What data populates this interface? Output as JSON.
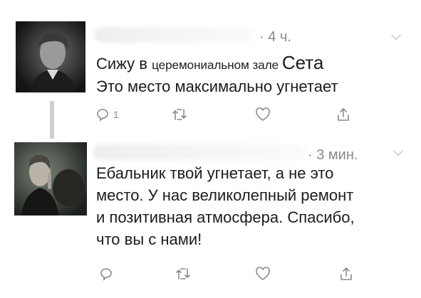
{
  "tweets": [
    {
      "time": "· 4 ч.",
      "text_line1_a": "Сижу в ",
      "text_line1_b": "церемониальном зале ",
      "text_line1_c": "Сета",
      "text_line2": "Это место максимально угнетает",
      "reply_count": "1"
    },
    {
      "time": "· 3 мин.",
      "text_lines": [
        "Ебальник твой угнетает, а не это",
        "место. У нас великолепный ремонт",
        "и позитивная атмосфера. Спасибо,",
        "что вы с нами!"
      ],
      "reply_count": ""
    }
  ],
  "icons": {
    "reply": "reply-icon",
    "retweet": "retweet-icon",
    "like": "heart-icon",
    "share": "share-icon",
    "menu": "chevron-down-icon"
  },
  "colors": {
    "icon": "#8a8a8a",
    "thread_line": "#cfcfcf"
  }
}
